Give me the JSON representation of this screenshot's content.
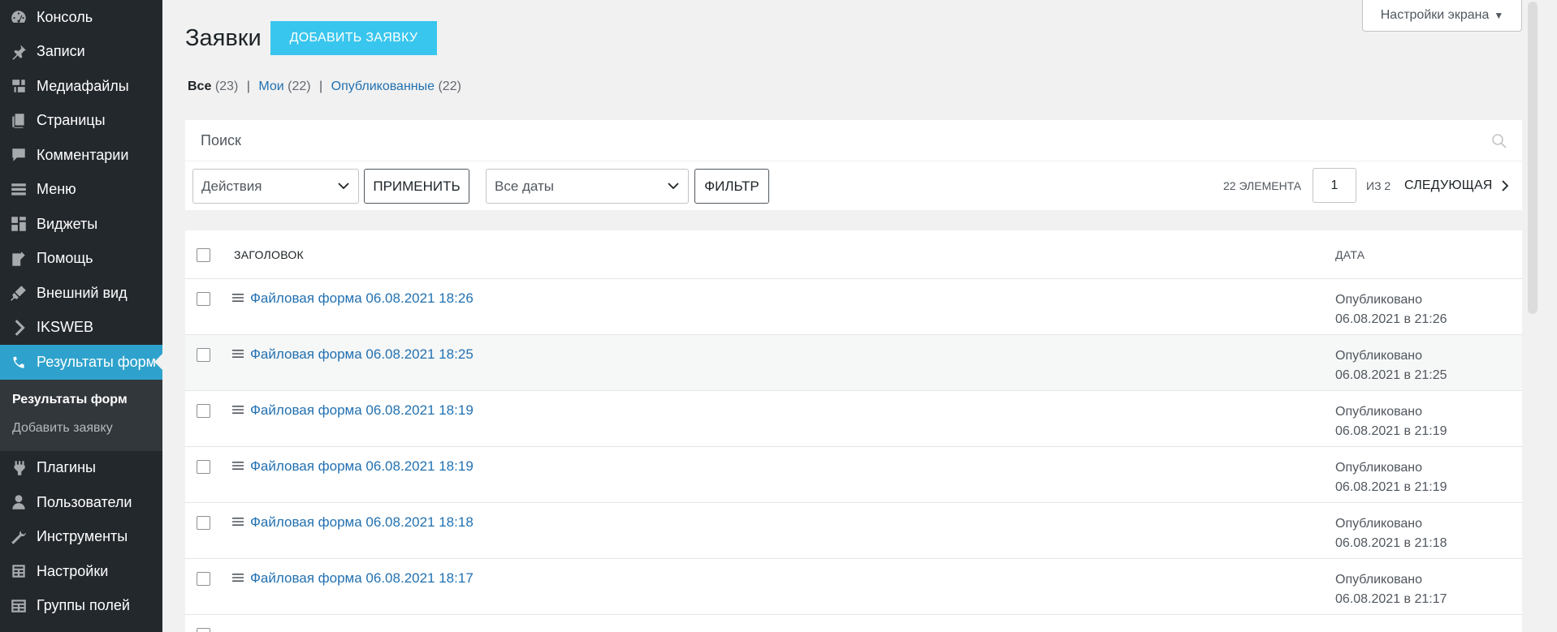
{
  "sidebar": {
    "items": [
      {
        "label": "Консоль",
        "icon": "dashboard-icon"
      },
      {
        "label": "Записи",
        "icon": "pin-icon"
      },
      {
        "label": "Медиафайлы",
        "icon": "media-icon"
      },
      {
        "label": "Страницы",
        "icon": "pages-icon"
      },
      {
        "label": "Комментарии",
        "icon": "comment-icon"
      },
      {
        "label": "Меню",
        "icon": "menu-list-icon"
      },
      {
        "label": "Виджеты",
        "icon": "widgets-icon"
      },
      {
        "label": "Помощь",
        "icon": "help-icon"
      },
      {
        "label": "Внешний вид",
        "icon": "brush-icon"
      },
      {
        "label": "IKSWEB",
        "icon": "chevron-right-icon"
      },
      {
        "label": "Результаты форм",
        "icon": "phone-icon"
      }
    ],
    "submenu": [
      {
        "label": "Результаты форм"
      },
      {
        "label": "Добавить заявку"
      }
    ],
    "items_after": [
      {
        "label": "Плагины",
        "icon": "plugin-icon"
      },
      {
        "label": "Пользователи",
        "icon": "user-icon"
      },
      {
        "label": "Инструменты",
        "icon": "wrench-icon"
      },
      {
        "label": "Настройки",
        "icon": "settings-icon"
      },
      {
        "label": "Группы полей",
        "icon": "fields-icon"
      }
    ]
  },
  "header": {
    "title": "Заявки",
    "add_button": "ДОБАВИТЬ ЗАЯВКУ",
    "screen_options": "Настройки экрана"
  },
  "filters": {
    "all_label": "Все",
    "all_count": "(23)",
    "mine_label": "Мои",
    "mine_count": "(22)",
    "published_label": "Опубликованные",
    "published_count": "(22)",
    "separator": "|"
  },
  "search": {
    "placeholder": "Поиск"
  },
  "tablenav": {
    "bulk_actions": "Действия",
    "apply": "ПРИМЕНИТЬ",
    "dates": "Все даты",
    "filter": "ФИЛЬТР",
    "count": "22 ЭЛЕМЕНТА",
    "page": "1",
    "of": "ИЗ 2",
    "next": "СЛЕДУЮЩАЯ"
  },
  "table": {
    "columns": {
      "title": "ЗАГОЛОВОК",
      "date": "ДАТА"
    },
    "rows": [
      {
        "title": "Файловая форма 06.08.2021 18:26",
        "status": "Опубликовано",
        "date": "06.08.2021 в 21:26"
      },
      {
        "title": "Файловая форма 06.08.2021 18:25",
        "status": "Опубликовано",
        "date": "06.08.2021 в 21:25"
      },
      {
        "title": "Файловая форма 06.08.2021 18:19",
        "status": "Опубликовано",
        "date": "06.08.2021 в 21:19"
      },
      {
        "title": "Файловая форма 06.08.2021 18:19",
        "status": "Опубликовано",
        "date": "06.08.2021 в 21:19"
      },
      {
        "title": "Файловая форма 06.08.2021 18:18",
        "status": "Опубликовано",
        "date": "06.08.2021 в 21:18"
      },
      {
        "title": "Файловая форма 06.08.2021 18:17",
        "status": "Опубликовано",
        "date": "06.08.2021 в 21:17"
      }
    ]
  },
  "colors": {
    "sidebar_bg": "#23282d",
    "active_item": "#2ea2cc",
    "add_button": "#39c6ee",
    "link": "#2271b1"
  }
}
